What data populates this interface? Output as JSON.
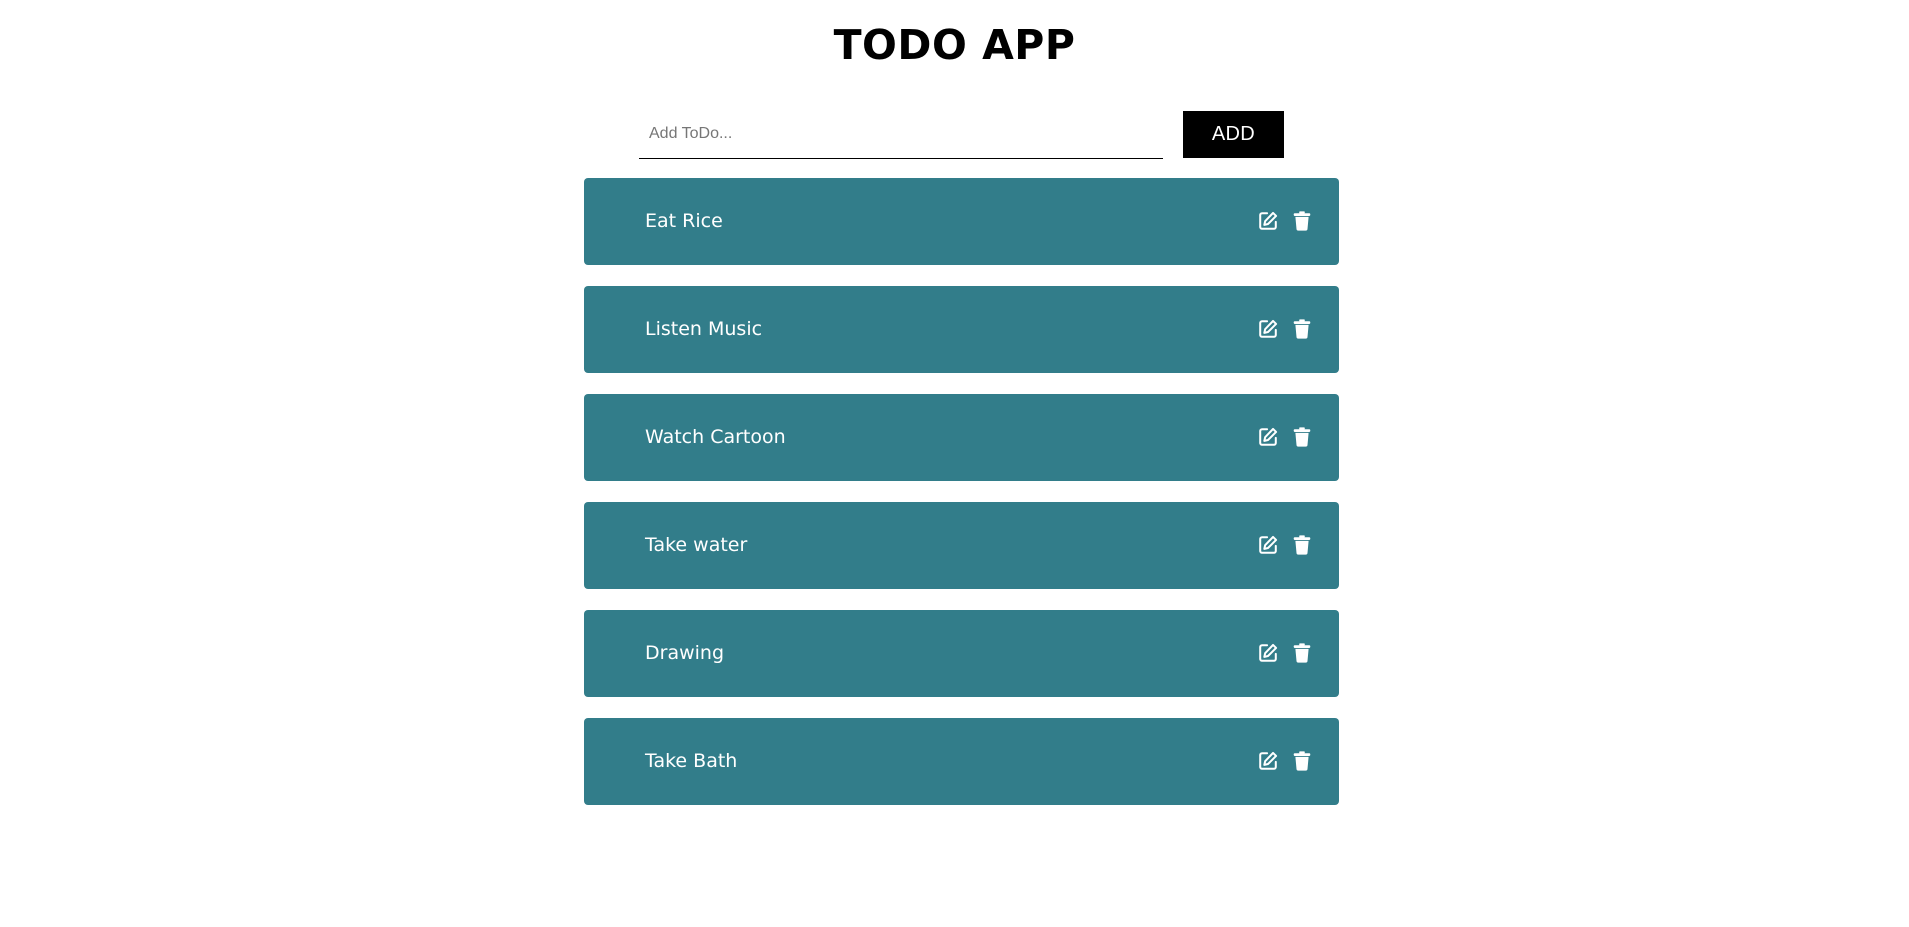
{
  "app": {
    "title": "TODO APP"
  },
  "add_form": {
    "placeholder": "Add ToDo...",
    "value": "",
    "button_label": "ADD"
  },
  "todos": [
    {
      "label": "Eat Rice"
    },
    {
      "label": "Listen Music"
    },
    {
      "label": "Watch Cartoon"
    },
    {
      "label": "Take water"
    },
    {
      "label": "Drawing"
    },
    {
      "label": "Take Bath"
    }
  ],
  "icons": {
    "edit": "edit-icon",
    "delete": "trash-icon"
  },
  "colors": {
    "item_background": "#327d8a",
    "item_text": "#ffffff",
    "button_background": "#000000",
    "button_text": "#ffffff"
  }
}
